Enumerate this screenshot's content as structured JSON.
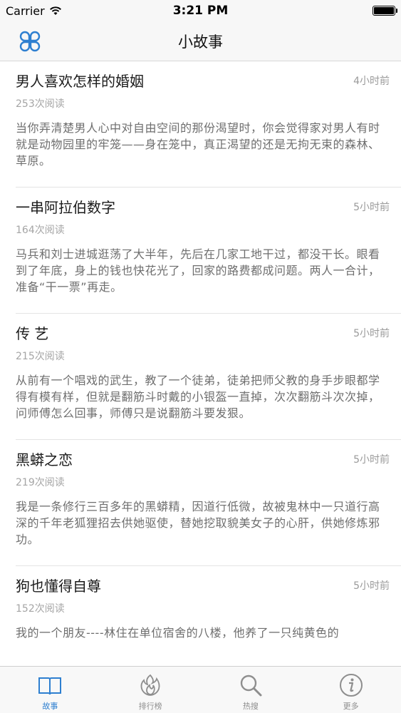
{
  "status_bar": {
    "carrier": "Carrier",
    "time": "3:21 PM",
    "battery_level": 1.0
  },
  "nav": {
    "title": "小故事",
    "menu_icon": "clover-menu-icon"
  },
  "stories": [
    {
      "title": "男人喜欢怎样的婚姻",
      "time": "4小时前",
      "reads": "253次阅读",
      "summary": "当你弄清楚男人心中对自由空间的那份渴望时，你会觉得家对男人有时就是动物园里的牢笼——身在笼中，真正渴望的还是无拘无束的森林、草原。"
    },
    {
      "title": "一串阿拉伯数字",
      "time": "5小时前",
      "reads": "164次阅读",
      "summary": "马兵和刘士进城逛荡了大半年，先后在几家工地干过，都没干长。眼看到了年底，身上的钱也快花光了，回家的路费都成问题。两人一合计，准备“干一票”再走。"
    },
    {
      "title": "传 艺",
      "time": "5小时前",
      "reads": "215次阅读",
      "summary": "从前有一个唱戏的武生，教了一个徒弟，徒弟把师父教的身手步眼都学得有模有样，但就是翻筋斗时戴的小银盔一直掉，次次翻筋斗次次掉，问师傅怎么回事，师傅只是说翻筋斗要发狠。"
    },
    {
      "title": "黑蟒之恋",
      "time": "5小时前",
      "reads": "219次阅读",
      "summary": "我是一条修行三百多年的黑蟒精，因道行低微，故被鬼林中一只道行高深的千年老狐狸招去供她驱使，替她挖取貌美女子的心肝，供她修炼邪功。"
    },
    {
      "title": "狗也懂得自尊",
      "time": "5小时前",
      "reads": "152次阅读",
      "summary": "我的一个朋友----林住在单位宿舍的八楼，他养了一只纯黄色的"
    }
  ],
  "tabs": [
    {
      "label": "故事",
      "icon": "book-icon",
      "active": true
    },
    {
      "label": "排行榜",
      "icon": "flame-icon",
      "active": false
    },
    {
      "label": "热搜",
      "icon": "search-icon",
      "active": false
    },
    {
      "label": "更多",
      "icon": "info-icon",
      "active": false
    }
  ],
  "colors": {
    "accent": "#2e7fd0",
    "inactive": "#8e8e8e"
  }
}
